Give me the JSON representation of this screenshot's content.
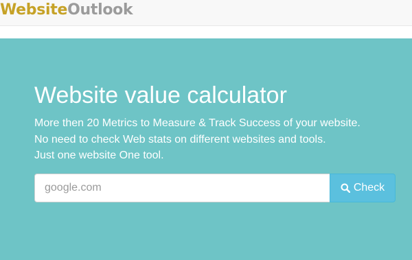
{
  "header": {
    "logo_part1": "Website",
    "logo_part2": "Outlook"
  },
  "hero": {
    "title": "Website value calculator",
    "lines": [
      "More then 20 Metrics to Measure & Track Success of your website.",
      "No need to check Web stats on different websites and tools.",
      "Just one website One tool."
    ]
  },
  "search": {
    "placeholder": "google.com",
    "value": "",
    "button_label": "Check",
    "button_icon": "search-icon"
  },
  "colors": {
    "hero_background": "#6ec4c6",
    "button_background": "#5bc0de",
    "logo_gold": "#c6a227",
    "logo_gray": "#9b9b9b"
  }
}
